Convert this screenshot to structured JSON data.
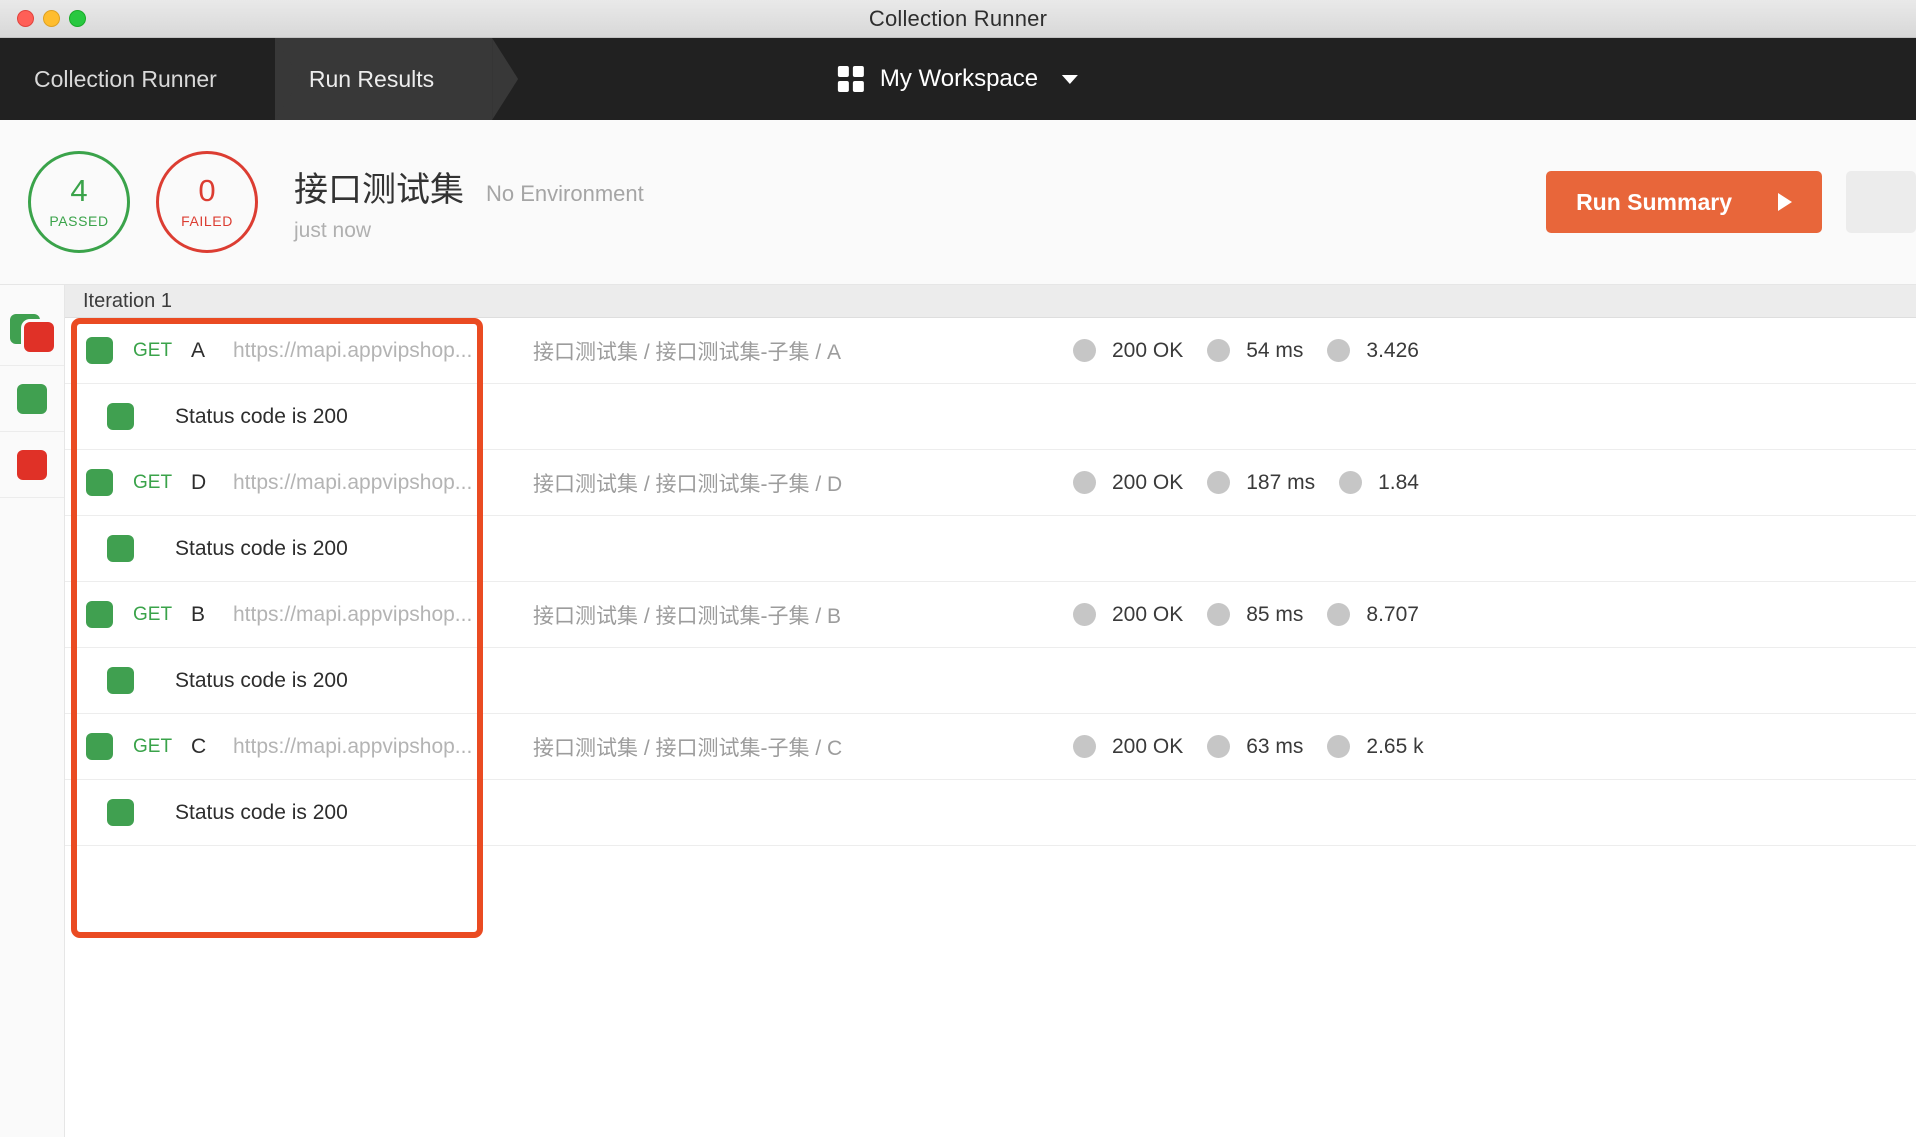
{
  "window": {
    "title": "Collection Runner"
  },
  "tabs": [
    {
      "label": "Collection Runner",
      "active": false
    },
    {
      "label": "Run Results",
      "active": true
    }
  ],
  "workspace": {
    "name": "My Workspace",
    "icon": "grid-icon",
    "caret": "chevron-down-icon"
  },
  "summary": {
    "passed": {
      "count": "4",
      "label": "PASSED",
      "color": "#3aa34a"
    },
    "failed": {
      "count": "0",
      "label": "FAILED",
      "color": "#dc3d32"
    },
    "collection_name": "接口测试集",
    "environment": "No Environment",
    "timestamp": "just now",
    "run_summary_button": "Run Summary"
  },
  "sidebar": {
    "items": [
      {
        "name": "all-results-filter",
        "icon": "green-red-stack-icon"
      },
      {
        "name": "passed-filter",
        "icon": "green-square-icon"
      },
      {
        "name": "failed-filter",
        "icon": "red-square-icon"
      }
    ]
  },
  "results": {
    "iteration_label": "Iteration 1",
    "rows": [
      {
        "method": "GET",
        "name": "A",
        "url": "https://mapi.appvipshop...",
        "path": "接口测试集 / 接口测试集-子集 / A",
        "status": "200 OK",
        "time": "54 ms",
        "size": "3.426",
        "test": "Status code is 200",
        "passed": true
      },
      {
        "method": "GET",
        "name": "D",
        "url": "https://mapi.appvipshop...",
        "path": "接口测试集 / 接口测试集-子集 / D",
        "status": "200 OK",
        "time": "187 ms",
        "size": "1.84",
        "test": "Status code is 200",
        "passed": true
      },
      {
        "method": "GET",
        "name": "B",
        "url": "https://mapi.appvipshop...",
        "path": "接口测试集 / 接口测试集-子集 / B",
        "status": "200 OK",
        "time": "85 ms",
        "size": "8.707",
        "test": "Status code is 200",
        "passed": true
      },
      {
        "method": "GET",
        "name": "C",
        "url": "https://mapi.appvipshop...",
        "path": "接口测试集 / 接口测试集-子集 / C",
        "status": "200 OK",
        "time": "63 ms",
        "size": "2.65 k",
        "test": "Status code is 200",
        "passed": true
      }
    ]
  },
  "annotation": {
    "color": "#ea4b22"
  }
}
